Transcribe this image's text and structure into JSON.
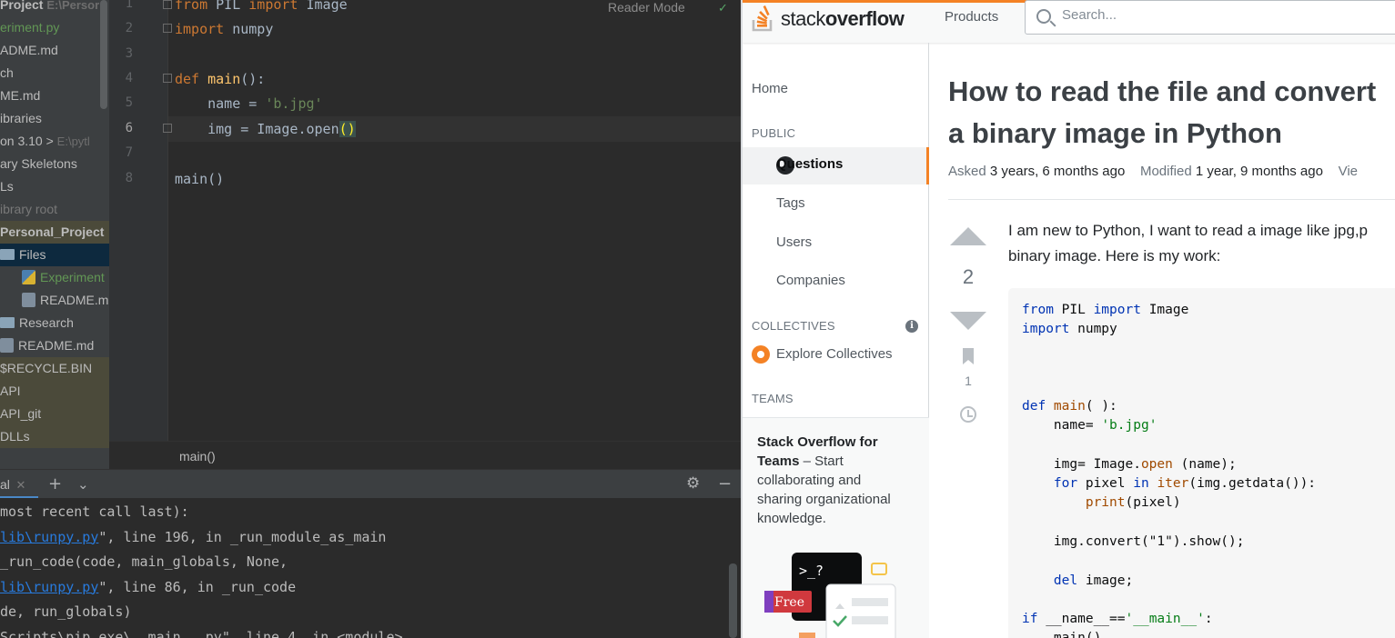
{
  "ide": {
    "tree": [
      {
        "text": "Project",
        "dim": "E:\\Persor",
        "style": "bold"
      },
      {
        "text": "eriment.py",
        "style": "green"
      },
      {
        "text": "ADME.md"
      },
      {
        "text": "ch"
      },
      {
        "text": "ME.md"
      },
      {
        "text": "ibraries"
      },
      {
        "text": "on 3.10 >",
        "dim": "E:\\pytl"
      },
      {
        "text": "ary Skeletons"
      },
      {
        "text": "Ls"
      },
      {
        "text": "ibrary root",
        "style": "gray"
      },
      {
        "text": "Personal_Project",
        "style": "bold-excluded"
      },
      {
        "text": "Files",
        "icon": "folder",
        "style": "selected"
      },
      {
        "text": "Experiment",
        "icon": "py",
        "indent": 1,
        "style": "green"
      },
      {
        "text": "README.m",
        "icon": "md",
        "indent": 1
      },
      {
        "text": "Research",
        "icon": "folder"
      },
      {
        "text": "README.md",
        "icon": "md"
      },
      {
        "text": "$RECYCLE.BIN",
        "style": "excluded"
      },
      {
        "text": "API",
        "style": "excluded"
      },
      {
        "text": "API_git",
        "style": "excluded"
      },
      {
        "text": "DLLs",
        "style": "excluded"
      }
    ],
    "line_numbers": [
      "1",
      "2",
      "3",
      "4",
      "5",
      "6",
      "7",
      "8"
    ],
    "current_line": "6",
    "code": {
      "l1_kw1": "from",
      "l1_mod": " PIL ",
      "l1_kw2": "import",
      "l1_name": " Image",
      "l2_kw": "import",
      "l2_name": " numpy",
      "l4_kw": "def",
      "l4_fn": "main",
      "l4_rest": "():",
      "l5_pre": "    name = ",
      "l5_str": "'b.jpg'",
      "l6_pre": "    img = Image.open",
      "l6_paren": "()",
      "l8": "main()"
    },
    "reader_mode": "Reader Mode",
    "breadcrumb": "main()",
    "terminal_tab": "al",
    "terminal_lines": [
      {
        "pre": "most recent call last):"
      },
      {
        "link": "lib\\runpy.py",
        "pre": "",
        "post": "\", line 196, in _run_module_as_main"
      },
      {
        "pre": "_run_code(code, main_globals, None,"
      },
      {
        "link": "lib\\runpy.py",
        "pre": "",
        "post": "\", line 86, in _run_code"
      },
      {
        "pre": "de, run_globals)"
      },
      {
        "pre": "Scripts\\pip.exe\\__main__.py\", line 4, in <module>"
      }
    ]
  },
  "so": {
    "logo_light": "stack",
    "logo_bold": "overflow",
    "products": "Products",
    "search_placeholder": "Search...",
    "nav": {
      "home": "Home",
      "public": "PUBLIC",
      "questions": "Questions",
      "tags": "Tags",
      "users": "Users",
      "companies": "Companies",
      "collectives": "COLLECTIVES",
      "explore": "Explore Collectives",
      "teams": "TEAMS",
      "teams_title": "Stack Overflow for Teams",
      "teams_desc": " – Start collaborating and sharing organizational knowledge.",
      "free_badge": "Free",
      "prompt": ">_?"
    },
    "question": {
      "title_line1": "How to read the file and convert",
      "title_line2": "a binary image in Python",
      "asked_label": "Asked",
      "asked_value": "3 years, 6 months ago",
      "modified_label": "Modified",
      "modified_value": "1 year, 9 months ago",
      "viewed_label": "Vie",
      "votes": "2",
      "bookmarks": "1",
      "body_line1": "I am new to Python, I want to read a image like jpg,p",
      "body_line2": "binary image. Here is my work:",
      "code": {
        "c1_kw1": "from",
        "c1_mid": " PIL ",
        "c1_kw2": "import",
        "c1_end": " Image",
        "c2_kw": "import",
        "c2_end": " numpy",
        "c5_kw": "def",
        "c5_fn": " main",
        "c5_end": "( ):",
        "c6_pre": "    name= ",
        "c6_str": "'b.jpg'",
        "c8_pre": "    img= Image.",
        "c8_fn": "open",
        "c8_end": " (name);",
        "c9_pre": "    ",
        "c9_kw1": "for",
        "c9_mid": " pixel ",
        "c9_kw2": "in",
        "c9_sp": " ",
        "c9_fn": "iter",
        "c9_end": "(img.getdata()):",
        "c10_pre": "        ",
        "c10_fn": "print",
        "c10_end": "(pixel)",
        "c12": "    img.convert(\"1\").show();",
        "c14_pre": "    ",
        "c14_kw": "del",
        "c14_end": " image;",
        "c16_kw": "if",
        "c16_mid": " __name__==",
        "c16_str": "'__main__'",
        "c16_end": ":",
        "c17": "    main()"
      }
    }
  },
  "colors": {
    "so_orange": "#f48225",
    "ide_keyword": "#cc7832",
    "ide_function": "#ffc66d",
    "ide_string": "#6a8759",
    "terminal_link": "#287bde"
  }
}
